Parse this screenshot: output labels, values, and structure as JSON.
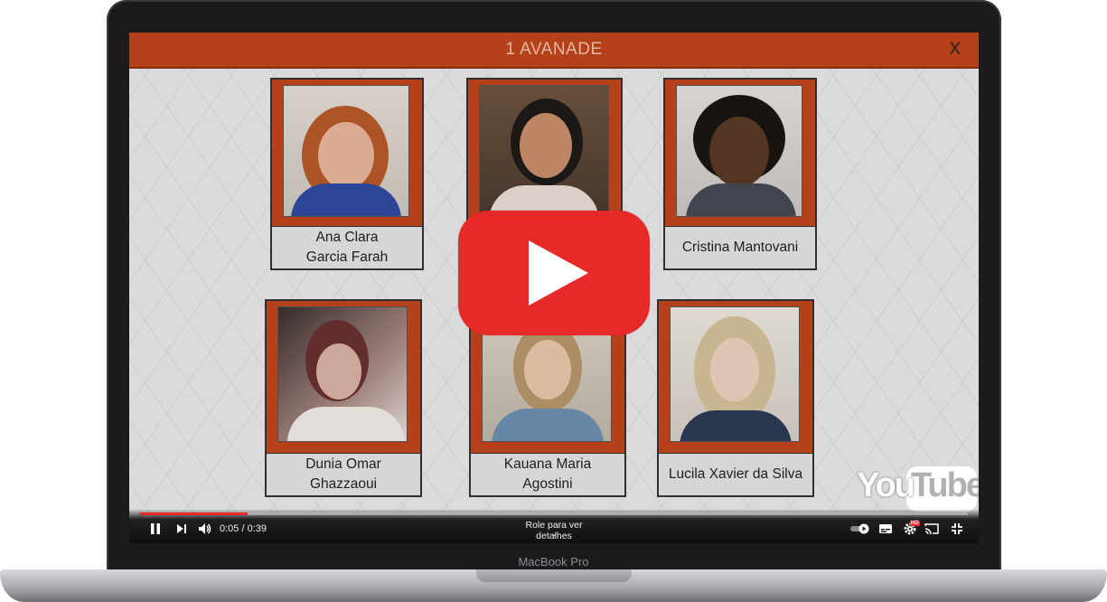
{
  "device": {
    "model_label": "MacBook Pro"
  },
  "slide": {
    "title": "1 AVANADE",
    "close_label": "X",
    "people": [
      {
        "name_line1": "Ana Clara",
        "name_line2": "Garcia Farah"
      },
      {
        "name_line1": "",
        "name_line2": ""
      },
      {
        "name_line1": "Cristina Mantovani",
        "name_line2": ""
      },
      {
        "name_line1": "Dunia Omar",
        "name_line2": "Ghazzaoui"
      },
      {
        "name_line1": "Kauana Maria",
        "name_line2": "Agostini"
      },
      {
        "name_line1": "Lucila Xavier da Silva",
        "name_line2": ""
      }
    ]
  },
  "player": {
    "time": "0:05 / 0:39",
    "progress": 0.13,
    "scroll_hint": "Role para ver detalhes",
    "logo_you": "You",
    "logo_tube": "Tube",
    "hd_badge": "HD",
    "accent_color": "#e62a2a"
  },
  "colors": {
    "frame": "#c1461c",
    "title_text": "#f2c2ac"
  }
}
